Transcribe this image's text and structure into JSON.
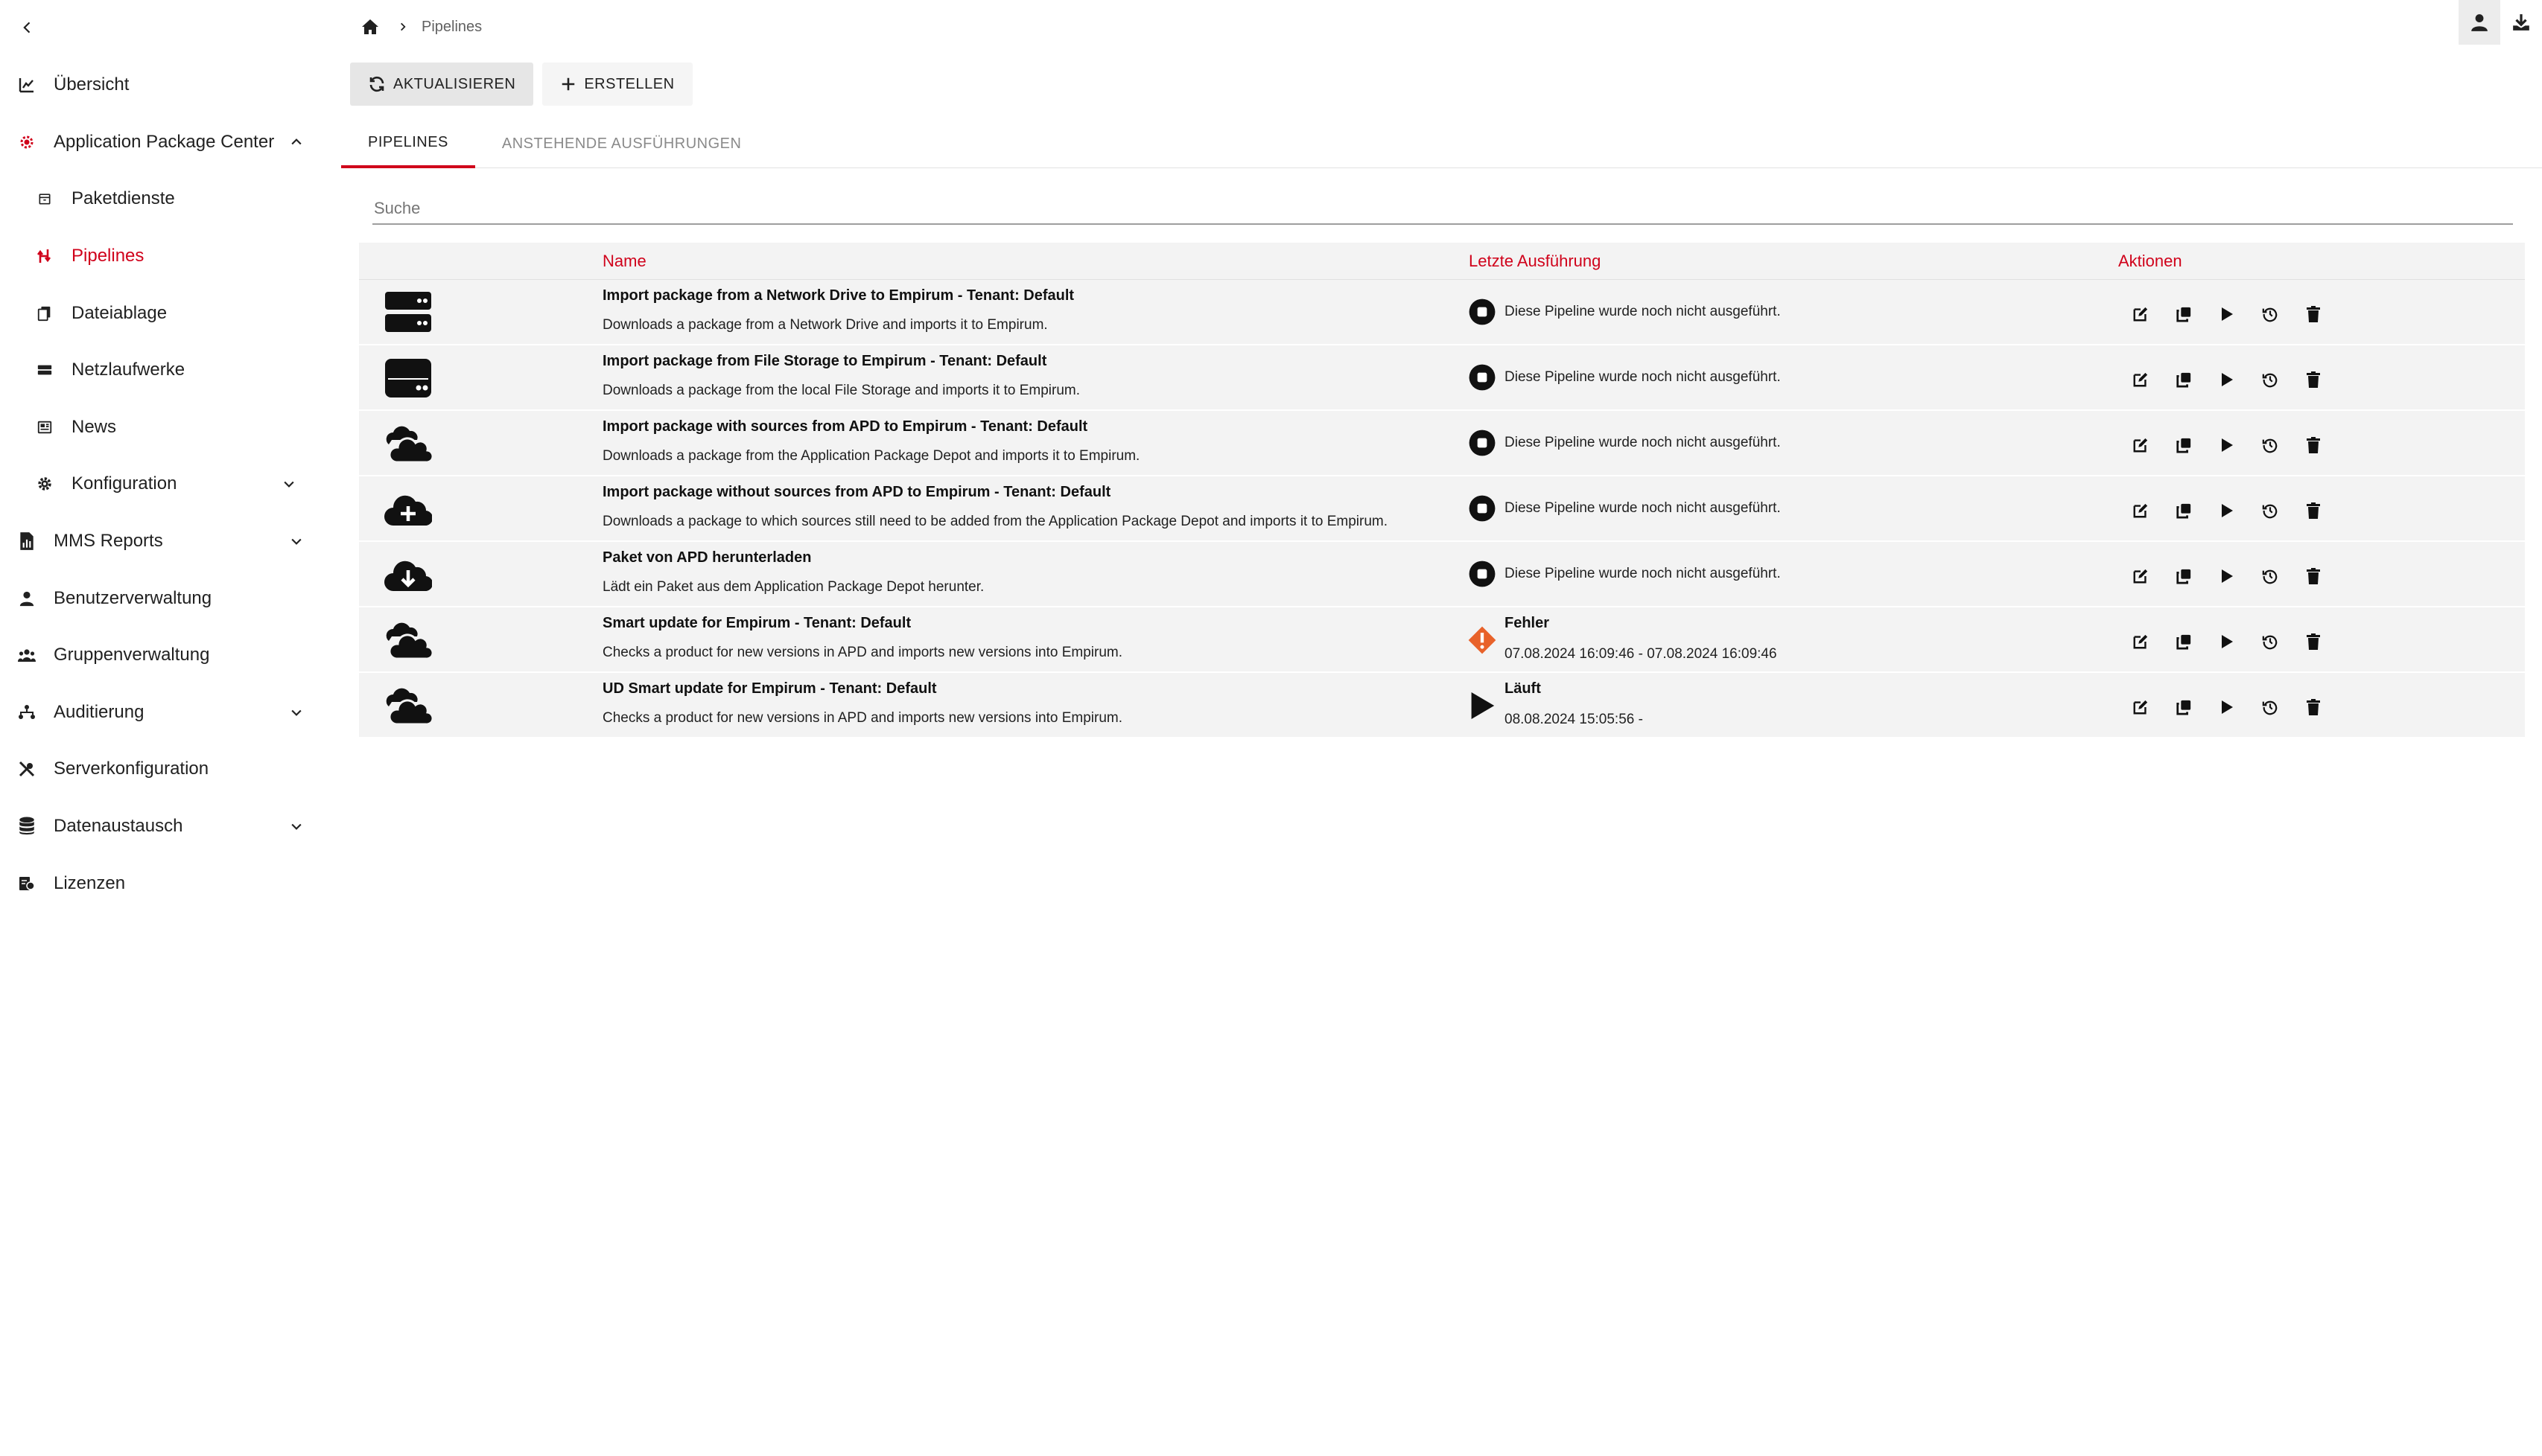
{
  "sidebar": {
    "items": [
      {
        "label": "Übersicht"
      },
      {
        "label": "Application Package Center"
      },
      {
        "label": "Paketdienste"
      },
      {
        "label": "Pipelines"
      },
      {
        "label": "Dateiablage"
      },
      {
        "label": "Netzlaufwerke"
      },
      {
        "label": "News"
      },
      {
        "label": "Konfiguration"
      },
      {
        "label": "MMS Reports"
      },
      {
        "label": "Benutzerverwaltung"
      },
      {
        "label": "Gruppenverwaltung"
      },
      {
        "label": "Auditierung"
      },
      {
        "label": "Serverkonfiguration"
      },
      {
        "label": "Datenaustausch"
      },
      {
        "label": "Lizenzen"
      }
    ]
  },
  "breadcrumb": {
    "current": "Pipelines"
  },
  "toolbar": {
    "refresh_label": "AKTUALISIEREN",
    "create_label": "ERSTELLEN"
  },
  "tabs": [
    {
      "label": "PIPELINES"
    },
    {
      "label": "ANSTEHENDE AUSFÜHRUNGEN"
    }
  ],
  "search": {
    "placeholder": "Suche"
  },
  "table": {
    "headers": {
      "name": "Name",
      "last_run": "Letzte Ausführung",
      "actions": "Aktionen"
    },
    "rows": [
      {
        "name": "Import package from a Network Drive to Empirum - Tenant: Default",
        "description": "Downloads a package from a Network Drive and imports it to Empirum.",
        "icon": "server-icon",
        "status": "Diese Pipeline wurde noch nicht ausgeführt.",
        "status_icon": "stop-circle-icon"
      },
      {
        "name": "Import package from File Storage to Empirum - Tenant: Default",
        "description": "Downloads a package from the local File Storage and imports it to Empirum.",
        "icon": "hdd-icon",
        "status": "Diese Pipeline wurde noch nicht ausgeführt.",
        "status_icon": "stop-circle-icon"
      },
      {
        "name": "Import package with sources from APD to Empirum - Tenant: Default",
        "description": "Downloads a package from the Application Package Depot and imports it to Empirum.",
        "icon": "clouds-icon",
        "status": "Diese Pipeline wurde noch nicht ausgeführt.",
        "status_icon": "stop-circle-icon"
      },
      {
        "name": "Import package without sources from APD to Empirum - Tenant: Default",
        "description": "Downloads a package to which sources still need to be added from the Application Package Depot and imports it to Empirum.",
        "icon": "cloud-plus-icon",
        "status": "Diese Pipeline wurde noch nicht ausgeführt.",
        "status_icon": "stop-circle-icon"
      },
      {
        "name": "Paket von APD herunterladen",
        "description": "Lädt ein Paket aus dem Application Package Depot herunter.",
        "icon": "cloud-download-icon",
        "status": "Diese Pipeline wurde noch nicht ausgeführt.",
        "status_icon": "stop-circle-icon"
      },
      {
        "name": "Smart update for Empirum - Tenant: Default",
        "description": "Checks a product for new versions in APD and imports new versions into Empirum.",
        "icon": "clouds-icon",
        "status_title": "Fehler",
        "status_time": "07.08.2024 16:09:46 - 07.08.2024 16:09:46",
        "status_icon": "warning-diamond-icon"
      },
      {
        "name": "UD Smart update for Empirum - Tenant: Default",
        "description": "Checks a product for new versions in APD and imports new versions into Empirum.",
        "icon": "clouds-icon",
        "status_title": "Läuft",
        "status_time": "08.08.2024 15:05:56 -",
        "status_icon": "play-icon"
      }
    ]
  },
  "colors": {
    "accent": "#d0021b",
    "error": "#e8622a",
    "row_bg": "#f3f3f3"
  }
}
